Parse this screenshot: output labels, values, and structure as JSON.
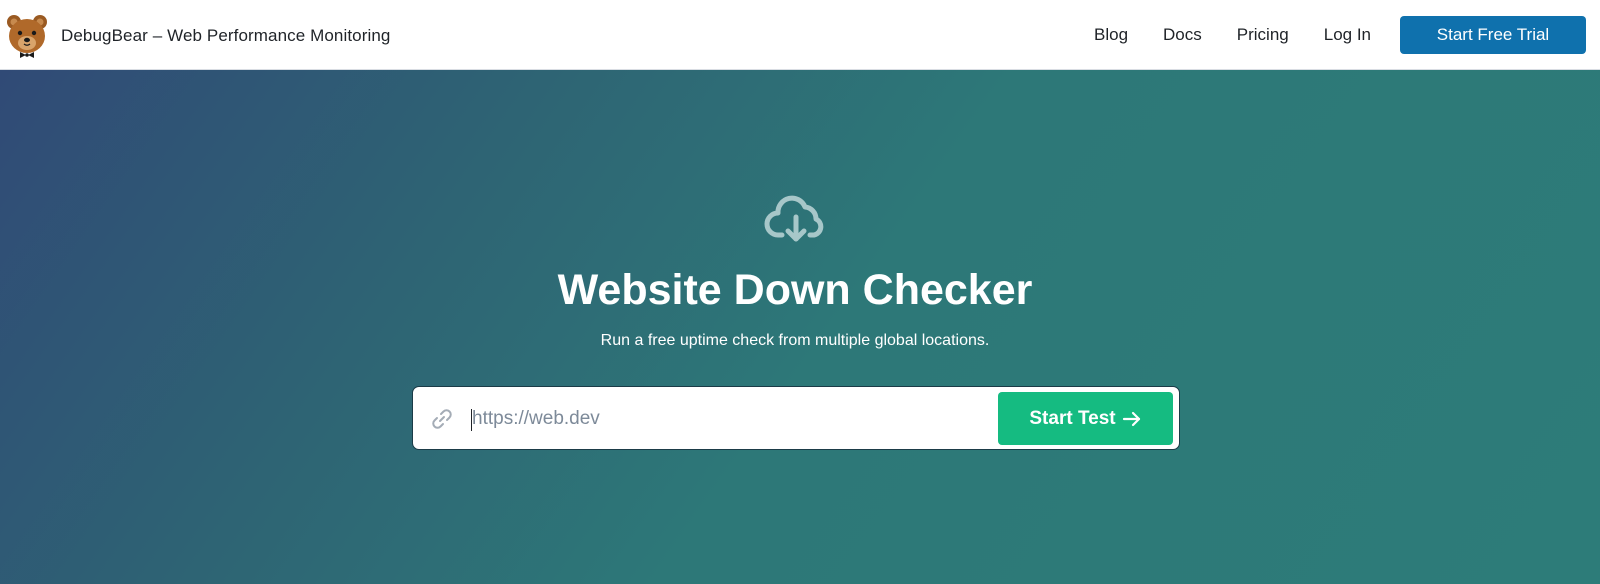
{
  "navbar": {
    "brand_text": "DebugBear – Web Performance Monitoring",
    "links": [
      {
        "label": "Blog"
      },
      {
        "label": "Docs"
      },
      {
        "label": "Pricing"
      },
      {
        "label": "Log In"
      }
    ],
    "cta_label": "Start Free Trial"
  },
  "hero": {
    "icon": "cloud-download-icon",
    "title": "Website Down Checker",
    "subtitle": "Run a free uptime check from multiple global locations.",
    "search": {
      "icon": "link-icon",
      "placeholder": "https://web.dev",
      "value": "",
      "button_label": "Start Test",
      "button_icon": "arrow-right-icon"
    }
  },
  "colors": {
    "nav_cta": "#0f71ad",
    "start_test": "#15bb81",
    "hero_gradient_start": "#304a76",
    "hero_gradient_end": "#2d7c79"
  }
}
